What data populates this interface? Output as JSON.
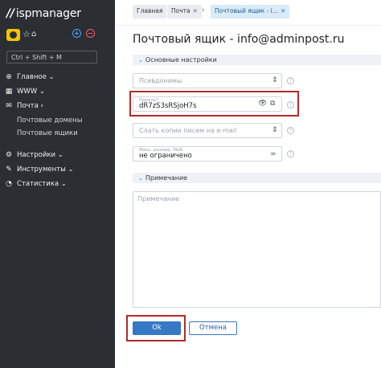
{
  "app": {
    "logo_mark": "//",
    "logo_text": "ispmanager"
  },
  "sidebar": {
    "shortcut": "Ctrl + Shift + M",
    "items": [
      {
        "icon": "globe-icon",
        "label": "Главное",
        "suffix": "⌄"
      },
      {
        "icon": "www-icon",
        "label": "WWW",
        "suffix": "⌄"
      },
      {
        "icon": "mail-icon",
        "label": "Почта",
        "suffix": "‹"
      }
    ],
    "subitems": [
      "Почтовые домены",
      "Почтовые ящики"
    ],
    "items2": [
      {
        "icon": "settings-icon",
        "label": "Настройки",
        "suffix": "⌄"
      },
      {
        "icon": "tools-icon",
        "label": "Инструменты",
        "suffix": "⌄"
      },
      {
        "icon": "stats-icon",
        "label": "Статистика",
        "suffix": "⌄"
      }
    ]
  },
  "tabs": {
    "home": "Главная",
    "mail": "Почта",
    "active": "Почтовый ящик - i..."
  },
  "page": {
    "title": "Почтовый ящик - info@adminpost.ru"
  },
  "sections": {
    "main": "Основные настройки",
    "note": "Примечание"
  },
  "form": {
    "aliases_placeholder": "Псевдонимы",
    "password_label": "Пароль*",
    "password_value": "dR7zS3sRSjoH7s",
    "copies_placeholder": "Слать копии писем на e-mail",
    "maxsize_label": "Макс. размер, МиБ",
    "maxsize_value": "не ограничено",
    "note_placeholder": "Примечание",
    "help": "?",
    "infinity": "∞"
  },
  "buttons": {
    "ok": "Ok",
    "cancel": "Отмена"
  },
  "colors": {
    "sidebar": "#2b2e33",
    "accent": "#3578c4",
    "highlight": "#b22a2a"
  }
}
